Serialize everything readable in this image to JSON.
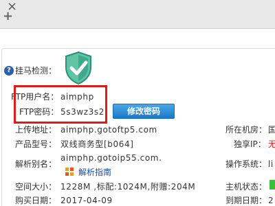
{
  "tab": {
    "close_glyph": "×",
    "new_tab_glyph": "+"
  },
  "help_icon_glyph": "?",
  "trojan_label": "挂马检测：",
  "ftp": {
    "username_label": "FTP用户名：",
    "username_value": "aimphp",
    "password_label": "FTP密码：",
    "password_value": "5s3wz3s2",
    "modify_button": "修改密码"
  },
  "rows": {
    "upload_label": "上传地址：",
    "upload_value": "aimphp.gotoftp5.com",
    "product_label": "产品型号：",
    "product_value": "双线商务型[b064]",
    "alias_label": "解析别名：",
    "alias_value": "aimphp.gotoip55.com.",
    "guide_link": "解析指南",
    "space_label": "空间大小：",
    "space_value": "1228M ,标配:1024M,附赠:204M",
    "purchase_label": "购买日期：",
    "purchase_value": "2017-04-09"
  },
  "right_col": {
    "room_label": "所在机房：",
    "room_value": "国",
    "ip_label": "独享IP：",
    "ip_value": "无",
    "os_label": "操作系统：",
    "os_value": "li",
    "host_label": "主机状态：",
    "expire_label": "到期日期：",
    "expire_value": "2"
  },
  "colors": {
    "highlight": "#e01919",
    "button": "#1d78c6",
    "link": "#1a4fa0",
    "shield": "#2aa088"
  }
}
